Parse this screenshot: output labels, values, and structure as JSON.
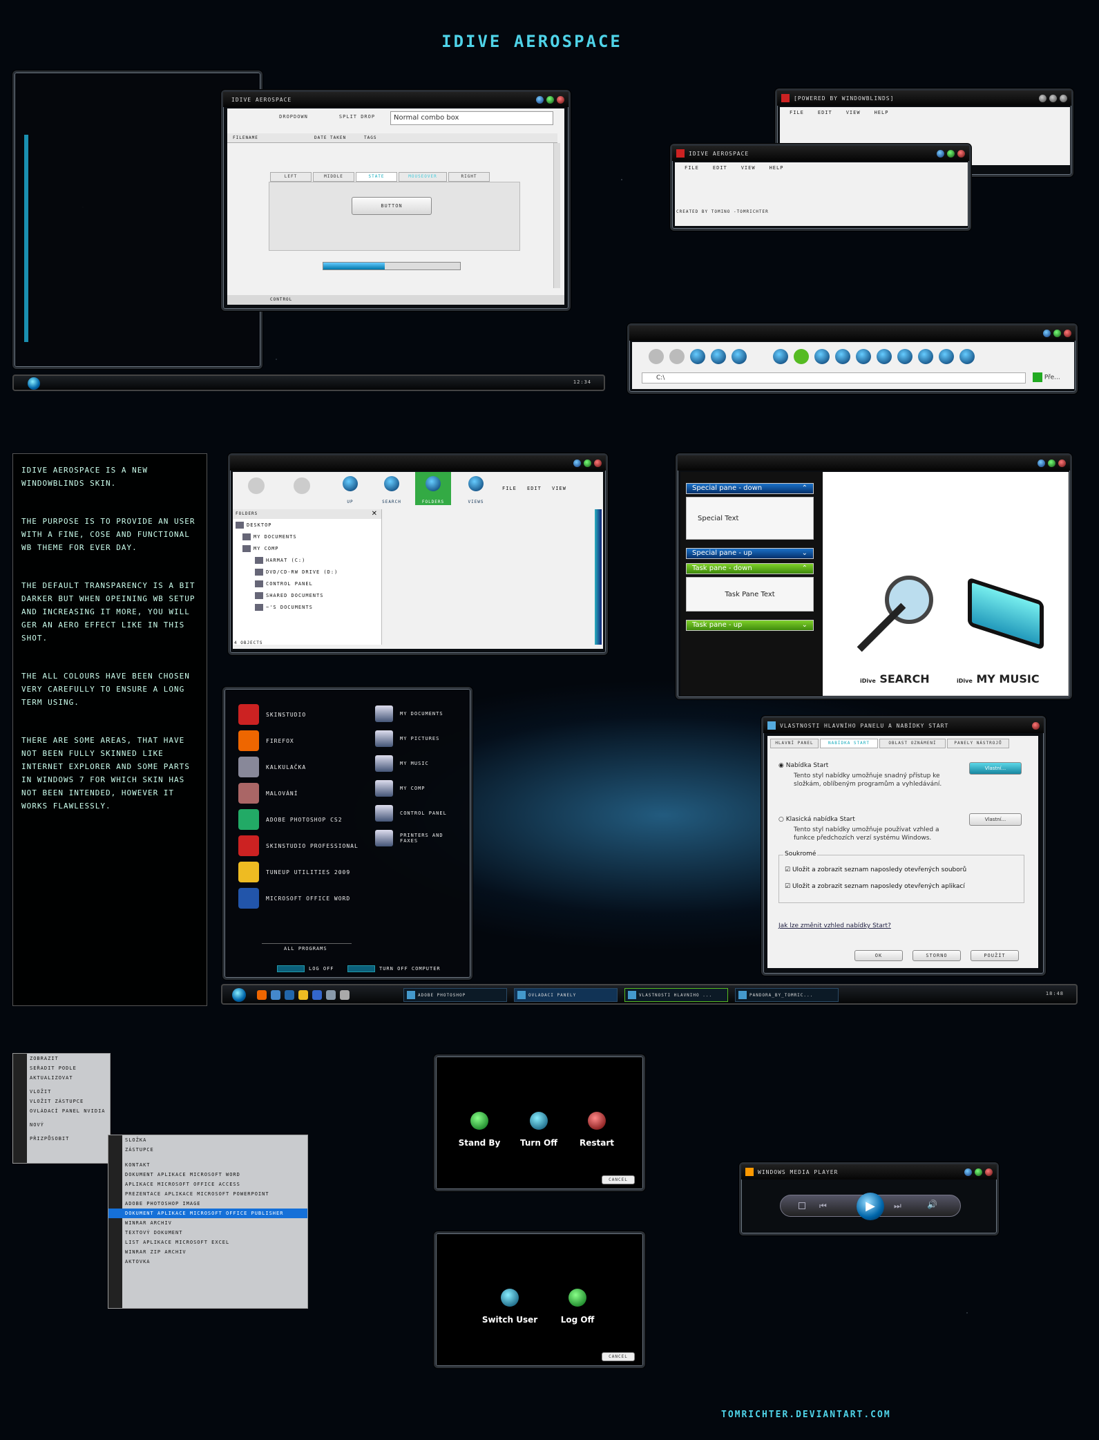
{
  "title": "iDive Aerospace",
  "main_window": {
    "title": "iDive Aerospace",
    "toolbar": {
      "dropdown": "Dropdown",
      "split_drop": "Split drop",
      "combo": "Normal combo box",
      "date_taken": "Date taken",
      "tags": "Tags",
      "filename": "Filename"
    },
    "tabs": [
      "Left",
      "Middle",
      "State",
      "Mouseover",
      "Right"
    ],
    "button": "Button",
    "progress_pct": 45,
    "status": "Control"
  },
  "wb_window": {
    "title": "[Powered by WindowBlinds]",
    "menu": [
      "File",
      "Edit",
      "View",
      "Help"
    ]
  },
  "small_window": {
    "title": "iDive Aerospace",
    "menu": [
      "File",
      "Edit",
      "View",
      "Help"
    ],
    "footer": "Created by Tomino -tomrichter"
  },
  "explorer_nav": {
    "address": "C:\\",
    "go_label": "Pře..."
  },
  "desc_panel": {
    "paragraphs": [
      "iDive Aerospace is a new WindowBlinds skin.",
      "The purpose is to provide an user with a fine, cose and functional WB theme for ever day.",
      "The default transparency is a bit darker but when opeining WB setup and increasing it more, you will ger an aero effect like in this shot.",
      "The all colours have been chosen very carefully to ensure a long term using.",
      "There are some areas, that have not been fully skinned like Internet Explorer and some parts in Windows 7 for which skin has not been intended, however it works flawlessly."
    ]
  },
  "taskbar_top": {
    "clock": "12:34"
  },
  "explorer": {
    "toolbar": [
      "Up",
      "Search",
      "Folders",
      "Views"
    ],
    "menu": [
      "File",
      "Edit",
      "View"
    ],
    "folders_header": "Folders",
    "tree": [
      "Desktop",
      "My Documents",
      "My Comp",
      "Harmat (C:)",
      "DVD/CD-RW Drive (D:)",
      "Control Panel",
      "Shared Documents",
      "~'s Documents"
    ],
    "status": "4 objects"
  },
  "taskpane": {
    "special_down": "Special pane - down",
    "special_text": "Special Text",
    "special_up": "Special pane - up",
    "task_down": "Task pane - down",
    "task_text": "Task Pane Text",
    "task_up": "Task pane - up",
    "search_brand": "iDive",
    "search_label": "SEARCH",
    "music_brand": "iDive",
    "music_label": "MY MUSIC"
  },
  "startmenu": {
    "left": [
      "SkinStudio",
      "Firefox",
      "Kalkulačka",
      "Malování",
      "Adobe Photoshop CS2",
      "SkinStudio Professional",
      "TuneUp Utilities 2009",
      "Microsoft Office Word"
    ],
    "right": [
      "My Documents",
      "My Pictures",
      "My Music",
      "My Comp",
      "Control Panel",
      "Printers and Faxes"
    ],
    "all_programs": "All programs",
    "log_off": "Log off",
    "turn_off": "Turn off computer"
  },
  "dialog": {
    "title": "Vlastnosti hlavního panelu a nabídky Start",
    "tabs": [
      "Hlavní panel",
      "Nabídka Start",
      "Oblast oznámení",
      "Panely nástrojů"
    ],
    "opt1": "Nabídka Start",
    "opt1_desc": "Tento styl nabídky umožňuje snadný přístup ke složkám, oblíbeným programům a vyhledávání.",
    "opt2": "Klasická nabídka Start",
    "opt2_desc": "Tento styl nabídky umožňuje používat vzhled a funkce předchozích verzí systému Windows.",
    "customize": "Vlastní...",
    "privacy_group": "Soukromé",
    "check1": "Uložit a zobrazit seznam naposledy otevřených souborů",
    "check2": "Uložit a zobrazit seznam naposledy otevřených aplikací",
    "link": "Jak lze změnit vzhled nabídky Start?",
    "ok": "OK",
    "cancel": "Storno",
    "apply": "Použít"
  },
  "taskbar_bottom": {
    "items": [
      "Adobe Photoshop",
      "Ovládací panely",
      "Vlastnosti hlavního ...",
      "pandora_by_tomric..."
    ],
    "clock": "18:48"
  },
  "context_menu": {
    "items": [
      "Zobrazit",
      "Seřadit podle",
      "Aktualizovat",
      "Vložit",
      "Vložit zástupce",
      "Ovládací panel NVIDIA",
      "Nový",
      "Přizpůsobit"
    ],
    "sub": [
      "Složka",
      "Zástupce",
      "Kontakt",
      "Dokument aplikace Microsoft Word",
      "Aplikace Microsoft Office Access",
      "Prezentace aplikace Microsoft PowerPoint",
      "Adobe Photoshop Image",
      "Dokument aplikace Microsoft Office Publisher",
      "WinRAR archiv",
      "Textový dokument",
      "List aplikace Microsoft Excel",
      "WinRAR ZIP archiv",
      "Aktovka"
    ]
  },
  "shutdown1": {
    "stand_by": "Stand By",
    "turn_off": "Turn Off",
    "restart": "Restart",
    "cancel": "Cancel"
  },
  "shutdown2": {
    "switch_user": "Switch User",
    "log_off": "Log Off",
    "cancel": "Cancel"
  },
  "wmp": {
    "title": "Windows Media Player"
  },
  "footer": "tomrichter.deviantart.com"
}
